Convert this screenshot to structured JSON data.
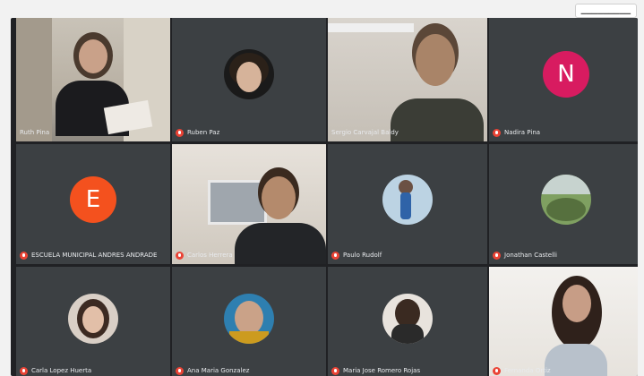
{
  "top_chip_text": "▁▁▁▁▁▁▁▁▁",
  "participants": [
    {
      "name": "Ruth Pina",
      "type": "video",
      "active": true
    },
    {
      "name": "Ruben Paz",
      "type": "photo"
    },
    {
      "name": "Sergio Carvajal Baldy",
      "type": "video"
    },
    {
      "name": "Nadira Pina",
      "type": "letter",
      "letter": "N",
      "color": "#d81b60"
    },
    {
      "name": "ESCUELA MUNICIPAL ANDRES ANDRADE",
      "type": "letter",
      "letter": "E",
      "color": "#f4511e"
    },
    {
      "name": "Carlos Herrera",
      "type": "video"
    },
    {
      "name": "Paulo Rudolf",
      "type": "photo"
    },
    {
      "name": "Jonathan Castelli",
      "type": "photo"
    },
    {
      "name": "Carla Lopez Huerta",
      "type": "photo"
    },
    {
      "name": "Ana Maria Gonzalez",
      "type": "photo"
    },
    {
      "name": "Maria Jose Romero Rojas",
      "type": "photo"
    },
    {
      "name": "Fernanda Ortiz",
      "type": "video"
    }
  ]
}
